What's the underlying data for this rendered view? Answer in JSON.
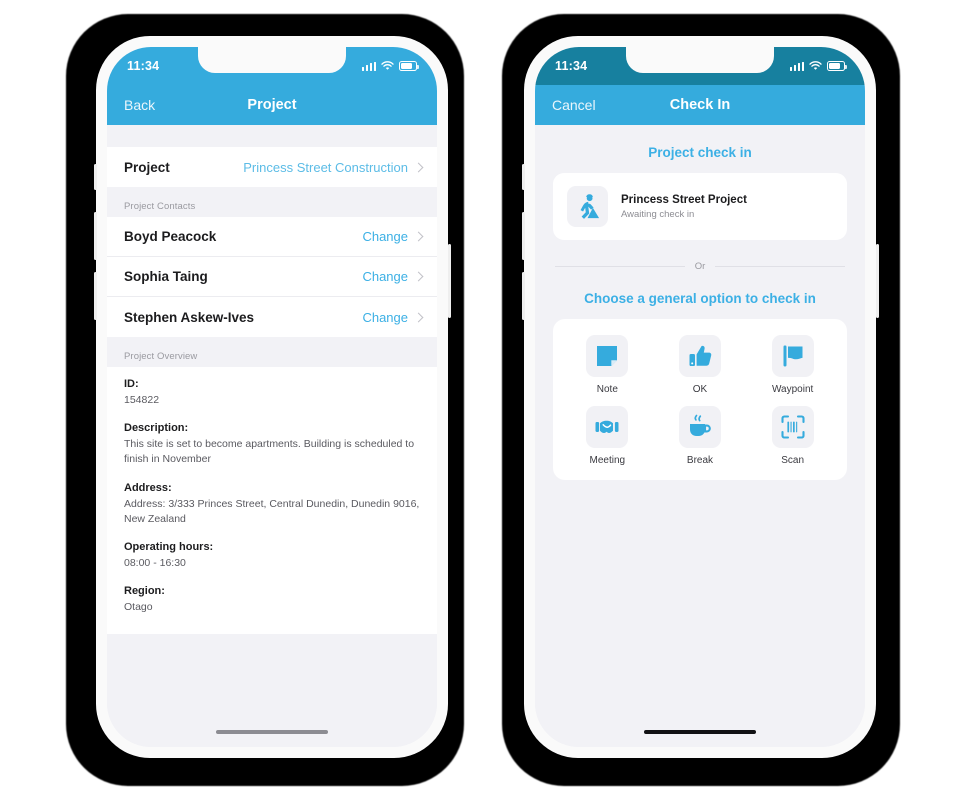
{
  "screens": [
    {
      "status": {
        "time": "11:34",
        "signal_icon": "signal-bars-icon",
        "wifi_icon": "wifi-icon",
        "battery_icon": "battery-icon"
      },
      "nav": {
        "left_label": "Back",
        "title": "Project"
      },
      "project_row": {
        "label": "Project",
        "value": "Princess Street Construction",
        "chevron_icon": "chevron-right-icon"
      },
      "contacts_header": "Project Contacts",
      "contacts": [
        {
          "name": "Boyd Peacock",
          "action": "Change"
        },
        {
          "name": "Sophia Taing",
          "action": "Change"
        },
        {
          "name": "Stephen Askew-Ives",
          "action": "Change"
        }
      ],
      "overview_header": "Project Overview",
      "overview": [
        {
          "key": "ID:",
          "value": "154822"
        },
        {
          "key": "Description:",
          "value": "This site is set to become apartments. Building is scheduled to finish in November"
        },
        {
          "key": "Address:",
          "value": "Address: 3/333 Princes Street, Central Dunedin, Dunedin 9016, New Zealand"
        },
        {
          "key": "Operating hours:",
          "value": "08:00 - 16:30"
        },
        {
          "key": "Region:",
          "value": "Otago"
        }
      ]
    },
    {
      "status": {
        "time": "11:34",
        "signal_icon": "signal-bars-icon",
        "wifi_icon": "wifi-icon",
        "battery_icon": "battery-icon"
      },
      "nav": {
        "left_label": "Cancel",
        "title": "Check In"
      },
      "section_title": "Project check in",
      "project_card": {
        "icon": "roadworks-worker-icon",
        "name": "Princess Street Project",
        "status": "Awaiting check in"
      },
      "divider_label": "Or",
      "options_title": "Choose a general option to check in",
      "options": [
        {
          "label": "Note",
          "icon": "sticky-note-icon"
        },
        {
          "label": "OK",
          "icon": "thumbs-up-icon"
        },
        {
          "label": "Waypoint",
          "icon": "flag-icon"
        },
        {
          "label": "Meeting",
          "icon": "handshake-icon"
        },
        {
          "label": "Break",
          "icon": "coffee-cup-icon"
        },
        {
          "label": "Scan",
          "icon": "barcode-scan-icon"
        }
      ]
    }
  ],
  "colors": {
    "nav_blue": "#35abdd",
    "status_blue_dark": "#17809f",
    "accent": "#3cb0e5",
    "link": "#5cbce6",
    "screen_bg": "#f2f2f6"
  }
}
